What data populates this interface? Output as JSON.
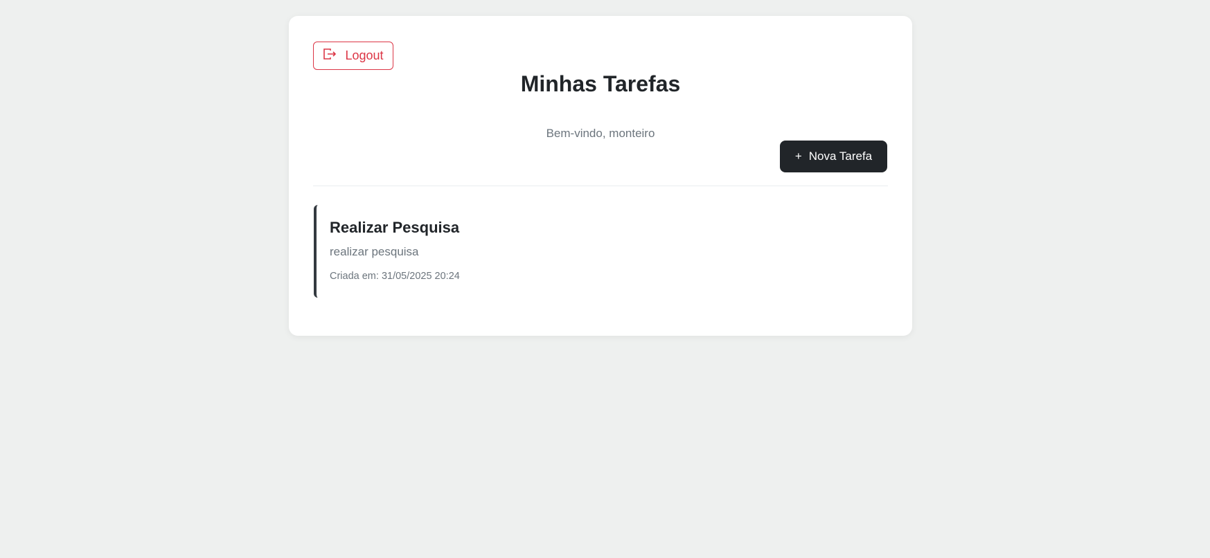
{
  "header": {
    "logout_label": "Logout",
    "title": "Minhas Tarefas",
    "welcome": "Bem-vindo, monteiro",
    "new_task_icon": "+",
    "new_task_label": "Nova Tarefa"
  },
  "tasks": [
    {
      "title": "Realizar Pesquisa",
      "description": "realizar pesquisa",
      "created": "Criada em: 31/05/2025 20:24"
    }
  ],
  "colors": {
    "danger": "#dc3545",
    "dark": "#212529",
    "border": "#343a40"
  }
}
